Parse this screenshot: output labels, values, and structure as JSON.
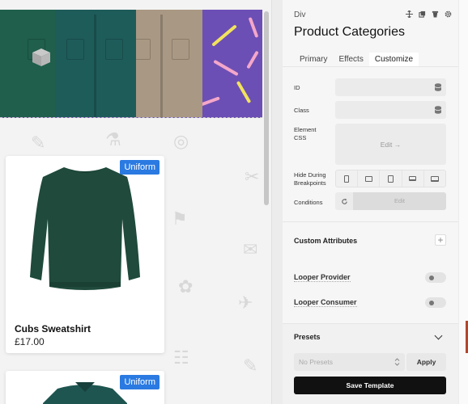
{
  "canvas": {
    "products": [
      {
        "badge": "Uniform",
        "name": "Cubs Sweatshirt",
        "price": "£17.00"
      },
      {
        "badge": "Uniform"
      }
    ],
    "icons": [
      "cube-icon"
    ]
  },
  "panel": {
    "element_type": "Div",
    "title": "Product Categories",
    "header_icons": [
      "move-icon",
      "duplicate-icon",
      "delete-icon",
      "settings-icon"
    ],
    "tabs": [
      {
        "label": "Primary",
        "active": false
      },
      {
        "label": "Effects",
        "active": false
      },
      {
        "label": "Customize",
        "active": true
      }
    ],
    "fields": {
      "id_label": "ID",
      "id_value": "",
      "class_label": "Class",
      "class_value": "",
      "element_css_label": "Element CSS",
      "element_css_button": "Edit →",
      "hide_label": "Hide During Breakpoints",
      "breakpoints": [
        "xl-icon",
        "lg-icon",
        "md-icon",
        "sm-icon",
        "xs-icon"
      ],
      "conditions_label": "Conditions",
      "conditions_button": "Edit"
    },
    "custom_attributes": {
      "title": "Custom Attributes",
      "add": "+"
    },
    "toggles": [
      {
        "label": "Looper Provider",
        "on": false
      },
      {
        "label": "Looper Consumer",
        "on": false
      }
    ],
    "presets": {
      "title": "Presets",
      "select_value": "No Presets",
      "apply_label": "Apply",
      "save_label": "Save Template"
    }
  },
  "colors": {
    "badge": "#2a7ae2",
    "banner": "#6c4fb5",
    "save_button": "#111111"
  }
}
